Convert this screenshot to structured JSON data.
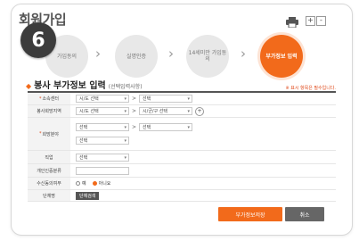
{
  "header": {
    "title": "회원가입",
    "step_badge": "6",
    "zoom_in_label": "+",
    "zoom_out_label": "-"
  },
  "steps": [
    {
      "label": "가입동의",
      "active": false
    },
    {
      "label": "실명인증",
      "active": false
    },
    {
      "label": "14세미만 가입동의",
      "active": false
    },
    {
      "label": "부가정보 입력",
      "active": true
    }
  ],
  "section": {
    "title": "봉사 부가정보 입력",
    "subtitle": "(선택입력사항)",
    "required_note": "※ 표시 항목은 필수입니다."
  },
  "form": {
    "rows": [
      {
        "label": "소속센터",
        "required": true,
        "select1": "시/도 선택",
        "select2": "선택"
      },
      {
        "label": "봉사희망지역",
        "required": false,
        "select1": "시/도 선택",
        "select2": "시/군/구 선택",
        "add_button": "+"
      },
      {
        "label": "희망분야",
        "required": true,
        "select1": "선택",
        "select2": "선택",
        "select3": "선택"
      },
      {
        "label": "직업",
        "required": false,
        "select1": "선택"
      },
      {
        "label": "개인인증분류",
        "required": false
      },
      {
        "label": "수신동의여부",
        "required": false,
        "option1": "예",
        "option2": "아니요"
      },
      {
        "label": "단체명",
        "required": false,
        "button": "단체검색"
      }
    ]
  },
  "footer": {
    "save_label": "부가정보저장",
    "cancel_label": "취소"
  },
  "colors": {
    "accent": "#f26a1b",
    "badge": "#3c3c3c",
    "cancel": "#666666"
  }
}
